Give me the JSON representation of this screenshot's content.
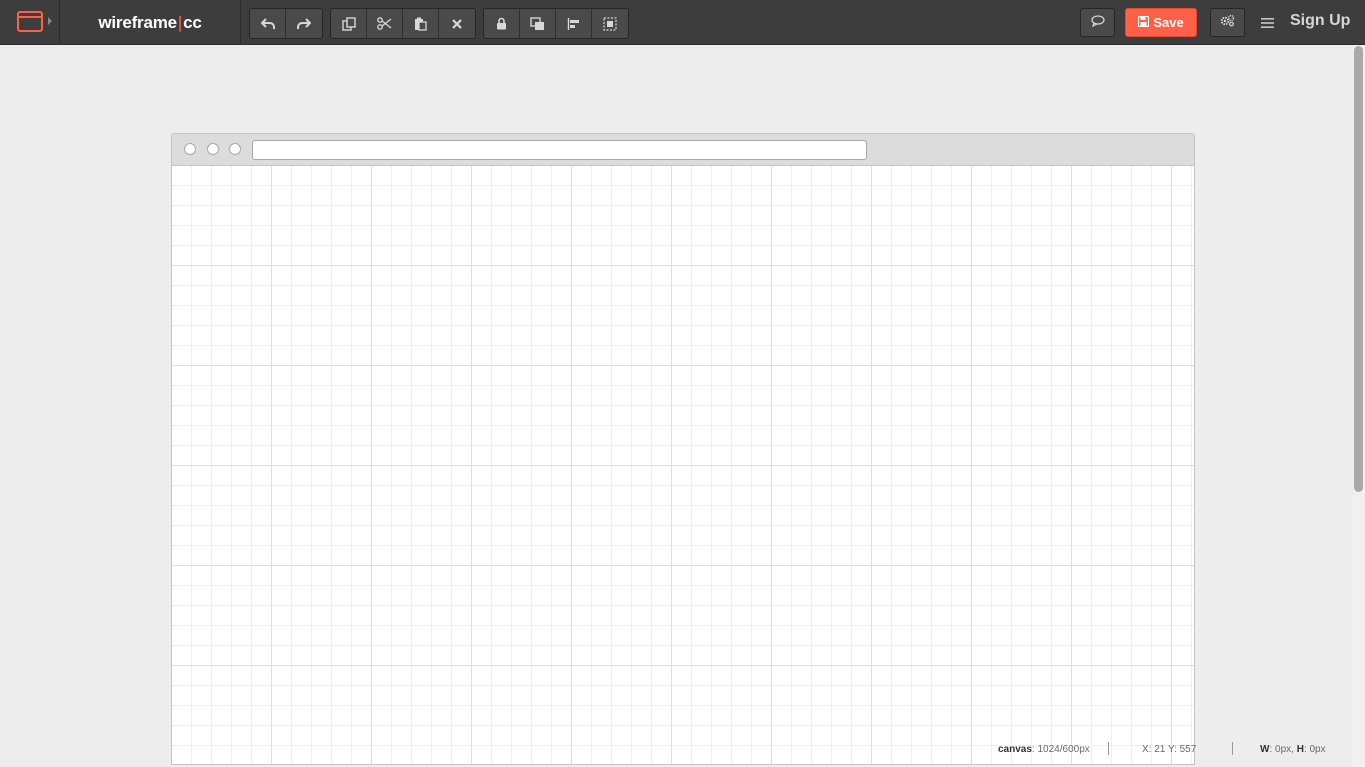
{
  "app": {
    "brand_left": "wireframe",
    "brand_sep": "|",
    "brand_right": "cc",
    "accent_color": "#ff6047"
  },
  "toolbar": {
    "history_group": [
      {
        "icon": "undo-icon"
      },
      {
        "icon": "redo-icon"
      }
    ],
    "edit_group": [
      {
        "icon": "copy-icon"
      },
      {
        "icon": "scissors-icon"
      },
      {
        "icon": "paste-icon"
      },
      {
        "icon": "close-icon"
      }
    ],
    "arrange_group": [
      {
        "icon": "lock-icon"
      },
      {
        "icon": "bring-to-front-icon"
      },
      {
        "icon": "align-icon"
      },
      {
        "icon": "select-frame-icon"
      }
    ],
    "comment_icon": "speech-bubble-icon",
    "save_label": "Save",
    "settings_icon": "gears-icon",
    "menu_icon": "hamburger-icon",
    "signup_label": "Sign Up"
  },
  "status": {
    "canvas_label": "canvas",
    "canvas_value": ": 1024/600px",
    "coords": "X: 21 Y: 557",
    "w_label": "W",
    "w_value": ": 0px, ",
    "h_label": "H",
    "h_value": ": 0px"
  }
}
